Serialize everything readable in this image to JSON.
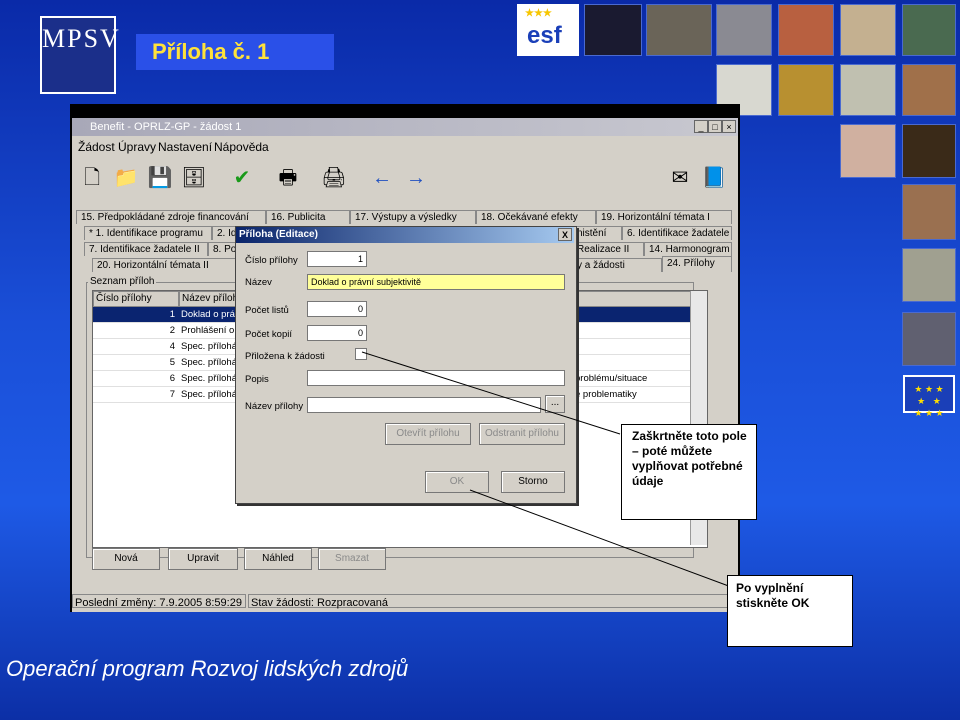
{
  "slide": {
    "logo": "MPSV",
    "title": "Příloha č. 1",
    "esf": "esf",
    "footer": "Operační program Rozvoj lidských zdrojů"
  },
  "window": {
    "title": "Benefit - OPRLZ-GP - žádost 1",
    "menu": [
      "Žádost",
      "Úpravy",
      "Nastavení",
      "Nápověda"
    ],
    "tabs_row1": [
      "15. Předpokládané zdroje financování",
      "16. Publicita",
      "17. Výstupy a výsledky",
      "18. Očekávané efekty",
      "19. Horizontální témata I"
    ],
    "tabs_row2": [
      "* 1. Identifikace programu",
      "2. Id",
      "nistění",
      "6. Identifikace žadatele"
    ],
    "tabs_row3": [
      "7. Identifikace žadatele II",
      "8. Po",
      "Realizace II",
      "14. Harmonogram"
    ],
    "tabs_row4": [
      "20. Horizontální témata II",
      "y a žádosti",
      "24. Přílohy"
    ],
    "group_label": "Seznam příloh",
    "columns": [
      "Číslo přílohy",
      "Název přílohy"
    ],
    "rows": [
      {
        "n": "1",
        "d": "Doklad o prá",
        "r": ""
      },
      {
        "n": "2",
        "d": "Prohlášení o",
        "r": ""
      },
      {
        "n": "4",
        "d": "Spec. přílohá",
        "r": ""
      },
      {
        "n": "5",
        "d": "Spec. přílohá",
        "r": ""
      },
      {
        "n": "6",
        "d": "Spec. přílohá",
        "r": "problému/situace"
      },
      {
        "n": "7",
        "d": "Spec. přílohá",
        "r": "e problematiky"
      }
    ],
    "buttons": [
      "Nová",
      "Upravit",
      "Náhled",
      "Smazat"
    ],
    "status_left": "Poslední změny: 7.9.2005 8:59:29",
    "status_right": "Stav žádosti: Rozpracovaná"
  },
  "dialog": {
    "title": "Příloha (Editace)",
    "close": "X",
    "labels": [
      "Číslo přílohy",
      "Název",
      "Počet listů",
      "Počet kopií",
      "Přiložena k žádosti",
      "Popis",
      "Název přílohy"
    ],
    "cislo_value": "1",
    "nazev_value": "Doklad o právní subjektivitě",
    "pocet_listu_value": "0",
    "pocet_kopii_value": "0",
    "browse": "...",
    "btn_open": "Otevřít přílohu",
    "btn_remove": "Odstranit přílohu",
    "btn_ok": "OK",
    "btn_cancel": "Storno"
  },
  "callouts": {
    "one": "Zaškrtněte toto pole – poté můžete vyplňovat potřebné údaje",
    "two_a": "Po vyplnění",
    "two_b": "stiskněte OK"
  },
  "colors": {
    "accent": "#ffe23a",
    "highlight": "#ffff99",
    "selection": "#0a2470"
  }
}
